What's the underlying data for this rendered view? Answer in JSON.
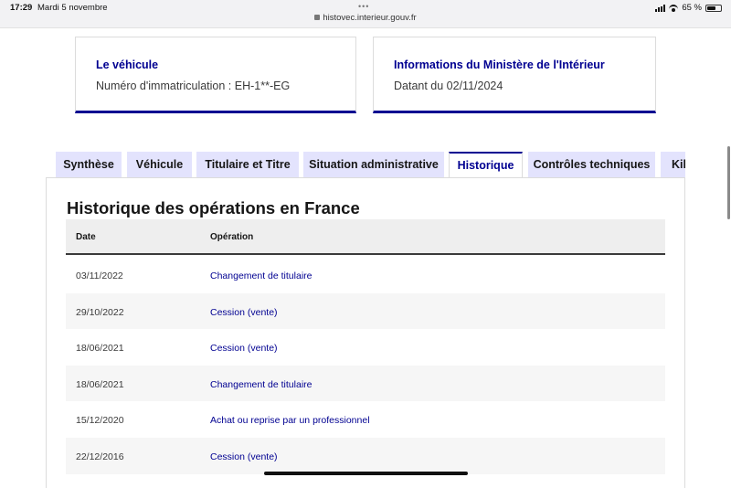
{
  "status_bar": {
    "time": "17:29",
    "date": "Mardi 5 novembre",
    "url": "histovec.interieur.gouv.fr",
    "battery": "65 %",
    "battery_level": 0.65
  },
  "cards": {
    "vehicle": {
      "title": "Le véhicule",
      "text": "Numéro d'immatriculation : EH-1**-EG"
    },
    "ministry": {
      "title": "Informations du Ministère de l'Intérieur",
      "text": "Datant du 02/11/2024"
    }
  },
  "tabs": [
    {
      "label": "Synthèse"
    },
    {
      "label": "Véhicule"
    },
    {
      "label": "Titulaire et Titre"
    },
    {
      "label": "Situation administrative"
    },
    {
      "label": "Historique"
    },
    {
      "label": "Contrôles techniques"
    },
    {
      "label": "Kilométrage"
    }
  ],
  "active_tab": "Historique",
  "section": {
    "title": "Historique des opérations en France",
    "columns": {
      "date": "Date",
      "operation": "Opération"
    },
    "rows": [
      {
        "date": "03/11/2022",
        "operation": "Changement de titulaire"
      },
      {
        "date": "29/10/2022",
        "operation": "Cession (vente)"
      },
      {
        "date": "18/06/2021",
        "operation": "Cession (vente)"
      },
      {
        "date": "18/06/2021",
        "operation": "Changement de titulaire"
      },
      {
        "date": "15/12/2020",
        "operation": "Achat ou reprise par un professionnel"
      },
      {
        "date": "22/12/2016",
        "operation": "Cession (vente)"
      }
    ]
  },
  "colors": {
    "accent": "#000091",
    "tab_bg": "#e3e3fd",
    "row_alt": "#f6f6f6"
  }
}
